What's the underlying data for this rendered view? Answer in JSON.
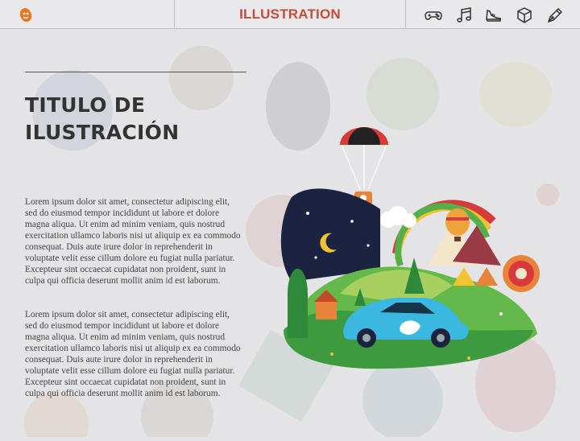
{
  "header": {
    "title": "ILLUSTRATION",
    "logo_icon": "lion-head-logo-icon",
    "nav_icons": [
      "gamepad-icon",
      "music-notes-icon",
      "sneaker-icon",
      "box-3d-icon",
      "pen-nib-icon"
    ],
    "accent_color": "#c74a3a"
  },
  "main": {
    "heading_line1": "TITULO DE",
    "heading_line2": "ILUSTRACIÓN",
    "paragraph1": "Lorem ipsum dolor sit amet, consectetur adipiscing elit, sed do eiusmod tempor incididunt ut labore et dolore magna aliqua. Ut enim ad minim veniam, quis nostrud exercitation ullamco laboris nisi ut aliquip ex ea commodo consequat. Duis aute irure dolor in reprehenderit in voluptate velit esse cillum dolore eu fugiat nulla pariatur. Excepteur sint occaecat cupidatat non proident, sunt in culpa qui officia deserunt mollit anim id est laborum.",
    "paragraph2": "Lorem ipsum dolor sit amet, consectetur adipiscing elit, sed do eiusmod tempor incididunt ut labore et dolore magna aliqua. Ut enim ad minim veniam, quis nostrud exercitation ullamco laboris nisi ut aliquip ex ea commodo consequat. Duis aute irure dolor in reprehenderit in voluptate velit esse cillum dolore eu fugiat nulla pariatur. Excepteur sint occaecat cupidatat non proident, sunt in culpa qui officia deserunt mollit anim id est laborum."
  }
}
